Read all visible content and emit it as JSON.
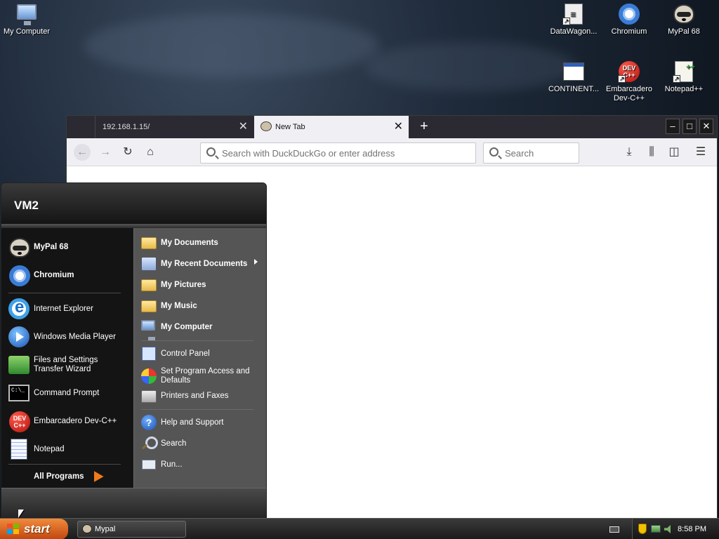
{
  "desktop": {
    "icons": {
      "my_computer": "My Computer",
      "datawagon": "DataWagon...",
      "chromium": "Chromium",
      "mypal": "MyPal 68",
      "continent": "CONTINENT...",
      "devcpp": "Embarcadero Dev-C++",
      "notepadpp": "Notepad++"
    }
  },
  "browser": {
    "tabs": [
      {
        "label": "192.168.1.15/",
        "active": false
      },
      {
        "label": "New Tab",
        "active": true
      }
    ],
    "toolbar": {
      "url_placeholder": "Search with DuckDuckGo or enter address",
      "search_placeholder": "Search"
    }
  },
  "start_menu": {
    "user": "VM2",
    "pinned": [
      {
        "label": "MyPal 68",
        "icon": "mypal-icon"
      },
      {
        "label": "Chromium",
        "icon": "chromium-icon"
      }
    ],
    "recent": [
      {
        "label": "Internet Explorer",
        "icon": "internet-explorer-icon"
      },
      {
        "label": "Windows Media Player",
        "icon": "media-player-icon"
      },
      {
        "label": "Files and Settings Transfer Wizard",
        "icon": "transfer-wizard-icon"
      },
      {
        "label": "Command Prompt",
        "icon": "command-prompt-icon"
      },
      {
        "label": "Embarcadero Dev-C++",
        "icon": "devcpp-icon"
      },
      {
        "label": "Notepad",
        "icon": "notepad-icon"
      }
    ],
    "all_programs": "All Programs",
    "places": [
      {
        "label": "My Documents",
        "icon": "folder-icon"
      },
      {
        "label": "My Recent Documents",
        "icon": "recent-documents-icon"
      },
      {
        "label": "My Pictures",
        "icon": "folder-icon"
      },
      {
        "label": "My Music",
        "icon": "folder-icon"
      },
      {
        "label": "My Computer",
        "icon": "computer-icon"
      }
    ],
    "settings": [
      {
        "label": "Control Panel",
        "icon": "control-panel-icon"
      },
      {
        "label": "Set Program Access and Defaults",
        "icon": "program-access-icon"
      },
      {
        "label": "Printers and Faxes",
        "icon": "printer-icon"
      }
    ],
    "help": [
      {
        "label": "Help and Support",
        "icon": "help-icon"
      },
      {
        "label": "Search",
        "icon": "search-icon"
      },
      {
        "label": "Run...",
        "icon": "run-icon"
      }
    ]
  },
  "taskbar": {
    "start_label": "start",
    "tasks": [
      {
        "label": "Mypal"
      }
    ],
    "clock": "8:58 PM"
  }
}
